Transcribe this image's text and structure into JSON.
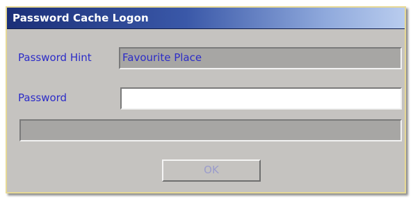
{
  "window": {
    "title": "Password Cache Logon"
  },
  "form": {
    "hint_label": "Password Hint",
    "hint_value": "Favourite Place",
    "password_label": "Password",
    "password_value": "",
    "status_text": ""
  },
  "buttons": {
    "ok_label": "OK"
  },
  "colors": {
    "title_gradient_start": "#1b2f78",
    "title_gradient_end": "#b9ccee",
    "label_text": "#2c2cc8",
    "dialog_background": "#c5c3c0",
    "readonly_field": "#a7a6a4",
    "disabled_button_text": "#9a9ccc"
  }
}
